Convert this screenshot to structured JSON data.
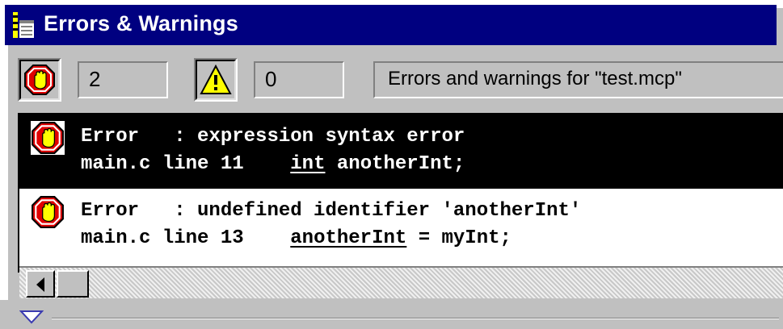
{
  "window": {
    "title": "Errors & Warnings",
    "icon": "document-icon"
  },
  "toolbar": {
    "errors_button_icon": "stop-hand-icon",
    "errors_count": "2",
    "warnings_button_icon": "warning-triangle-icon",
    "warnings_count": "0",
    "message": "Errors and warnings for \"test.mcp\""
  },
  "messages": [
    {
      "icon": "stop-hand-icon",
      "kind": "Error",
      "text": "expression syntax error",
      "file": "main.c",
      "line_label": "line 11",
      "code_highlight": "int",
      "code_rest": " anotherInt;",
      "selected": true
    },
    {
      "icon": "stop-hand-icon",
      "kind": "Error",
      "text": "undefined identifier 'anotherInt'",
      "file": "main.c",
      "line_label": "line 13",
      "code_highlight": "anotherInt",
      "code_rest": " = myInt;",
      "selected": false
    }
  ],
  "colors": {
    "titlebar": "#000080",
    "face": "#c0c0c0",
    "stop_red": "#e00000",
    "warning_yellow": "#ffff00"
  }
}
